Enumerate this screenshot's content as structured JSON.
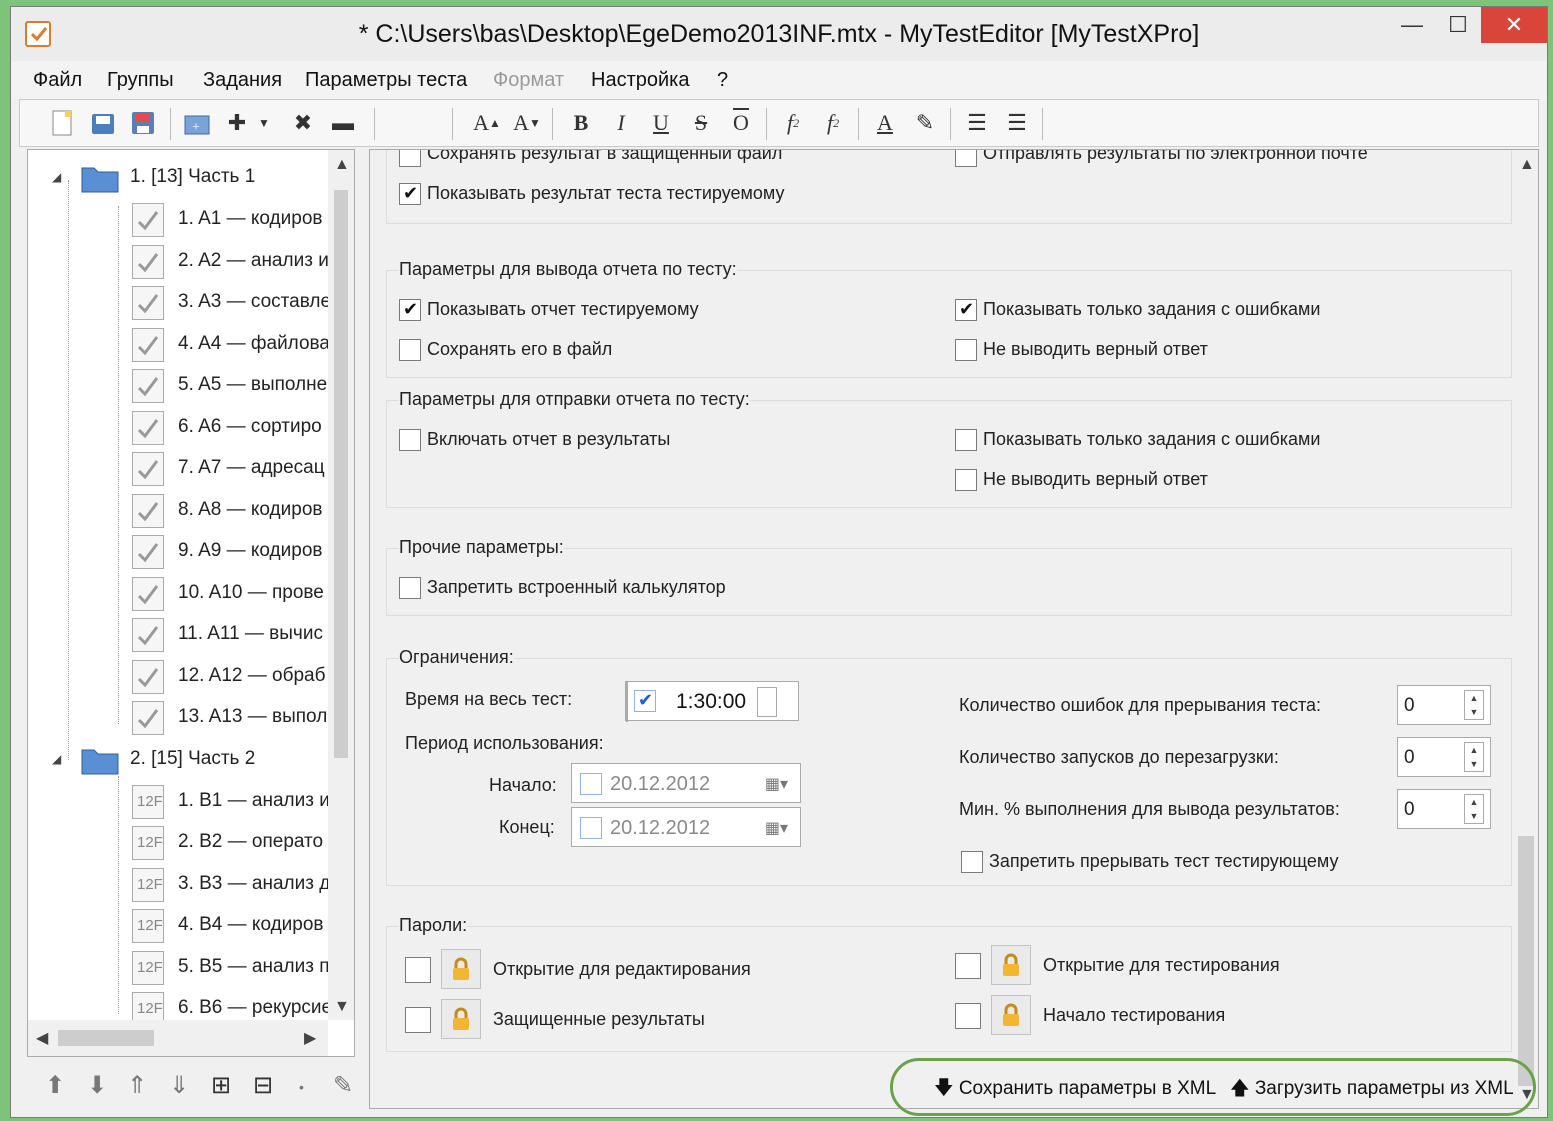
{
  "window": {
    "title": "* C:\\Users\\bas\\Desktop\\EgeDemo2013INF.mtx - MyTestEditor [MyTestXPro]",
    "min": "—",
    "max": "☐",
    "close": "✕"
  },
  "menu": [
    "Файл",
    "Группы",
    "Задания",
    "Параметры теста",
    "Формат",
    "Настройка",
    "?"
  ],
  "tree": {
    "groups": [
      {
        "label": "1. [13] Часть 1",
        "items": [
          "1. A1 — кодиров",
          "2. A2 — анализ и",
          "3. A3 — составле",
          "4. A4 — файлова",
          "5. A5 — выполне",
          "6. A6 — сортиро",
          "7. A7 — адресац",
          "8. A8 — кодиров",
          "9. A9 — кодиров",
          "10. A10 — прове",
          "11. A11 — вычис",
          "12. A12 — обраб",
          "13. A13 — выпол"
        ]
      },
      {
        "label": "2. [15] Часть 2",
        "items": [
          "1. B1 — анализ и",
          "2. B2 — операто",
          "3. B3 — анализ д",
          "4. B4 — кодиров",
          "5. B5 — анализ п",
          "6. B6 — рекурсие"
        ]
      }
    ]
  },
  "top_opts": {
    "save_protected": "Сохранять результат в защищенный файл",
    "send_email": "Отправлять результаты по электронной почте",
    "show_result": "Показывать результат теста тестируемому"
  },
  "report": {
    "title": "Параметры для вывода отчета по тесту:",
    "show_report": "Показывать отчет тестируемому",
    "save_to_file": "Сохранять его в файл",
    "only_errors": "Показывать только задания с ошибками",
    "no_correct": "Не выводить верный ответ"
  },
  "send_report": {
    "title": "Параметры для отправки отчета по тесту:",
    "include": "Включать отчет в результаты",
    "only_errors": "Показывать только задания с ошибками",
    "no_correct": "Не выводить верный ответ"
  },
  "other": {
    "title": "Прочие параметры:",
    "no_calc": "Запретить встроенный калькулятор"
  },
  "limits": {
    "title": "Ограничения:",
    "time_label": "Время на весь тест:",
    "time_value": "1:30:00",
    "period_label": "Период использования:",
    "start_label": "Начало:",
    "start_value": "20.12.2012",
    "end_label": "Конец:",
    "end_value": "20.12.2012",
    "errors_label": "Количество ошибок для прерывания теста:",
    "errors_value": "0",
    "launches_label": "Количество запусков до перезагрузки:",
    "launches_value": "0",
    "min_pct_label": "Мин. % выполнения для вывода результатов:",
    "min_pct_value": "0",
    "no_interrupt": "Запретить прерывать тест тестирующему"
  },
  "passwords": {
    "title": "Пароли:",
    "open_edit": "Открытие для редактирования",
    "protected_results": "Защищенные результаты",
    "open_test": "Открытие для тестирования",
    "start_test": "Начало тестирования"
  },
  "bottom": {
    "save_xml": "Сохранить параметры в XML",
    "load_xml": "Загрузить параметры из XML"
  },
  "colors": {
    "accent": "#6aa24a",
    "close_bg": "#d9453a"
  }
}
